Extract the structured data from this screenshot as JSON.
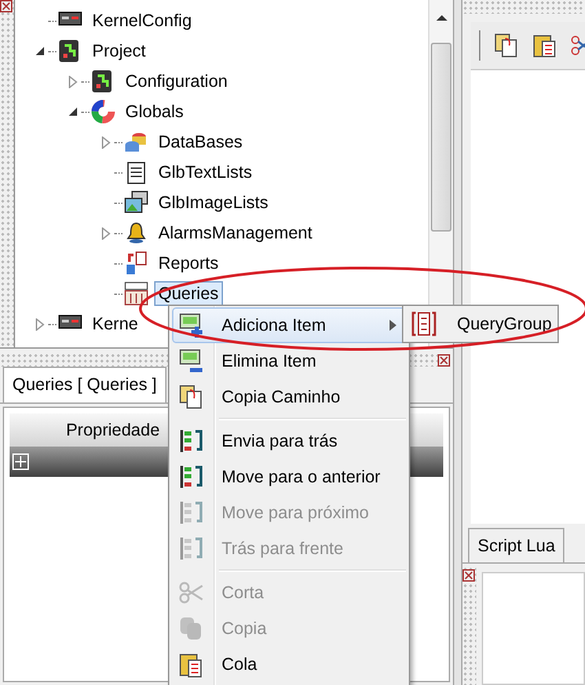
{
  "tree": [
    {
      "label": "KernelConfig",
      "kind": "config",
      "selected": false
    },
    {
      "label": "Project",
      "kind": "project",
      "selected": false,
      "expanded": true,
      "children": [
        {
          "label": "Configuration",
          "kind": "configuration",
          "selected": false,
          "expanded": false
        },
        {
          "label": "Globals",
          "kind": "globals",
          "selected": false,
          "expanded": true,
          "children": [
            {
              "label": "DataBases",
              "kind": "database",
              "selected": false,
              "expanded": false
            },
            {
              "label": "GlbTextLists",
              "kind": "textlist",
              "selected": false
            },
            {
              "label": "GlbImageLists",
              "kind": "imagelist",
              "selected": false
            },
            {
              "label": "AlarmsManagement",
              "kind": "alarm",
              "selected": false,
              "expanded": false
            },
            {
              "label": "Reports",
              "kind": "report",
              "selected": false
            },
            {
              "label": "Queries",
              "kind": "query",
              "selected": true
            }
          ]
        }
      ]
    },
    {
      "label": "Kerne",
      "kind": "kernel",
      "selected": false,
      "expanded": false
    }
  ],
  "properties_panel": {
    "tabs": [
      {
        "label": "Queries [ Queries ]",
        "selected": true
      }
    ],
    "column": "Propriedade"
  },
  "script_panel": {
    "tabs": [
      {
        "label": "Script Lua"
      }
    ]
  },
  "context_menu": [
    {
      "kind": "add",
      "label": "Adiciona Item",
      "disabled": false,
      "selected": true,
      "submenu": true
    },
    {
      "kind": "remove",
      "label": "Elimina Item",
      "disabled": false,
      "selected": false
    },
    {
      "kind": "copypath",
      "label": "Copia Caminho",
      "disabled": false,
      "selected": false
    },
    {
      "kind": "separator"
    },
    {
      "kind": "back",
      "label": "Envia para trás",
      "disabled": false,
      "selected": false
    },
    {
      "kind": "prev",
      "label": "Move para o anterior",
      "disabled": false,
      "selected": false
    },
    {
      "kind": "next",
      "label": "Move para próximo",
      "disabled": true,
      "selected": false
    },
    {
      "kind": "front",
      "label": "Trás para frente",
      "disabled": true,
      "selected": false
    },
    {
      "kind": "separator"
    },
    {
      "kind": "cut",
      "label": "Corta",
      "disabled": true,
      "selected": false
    },
    {
      "kind": "copy",
      "label": "Copia",
      "disabled": true,
      "selected": false
    },
    {
      "kind": "paste",
      "label": "Cola",
      "disabled": false,
      "selected": false
    }
  ],
  "submenu": [
    {
      "label": "QueryGroup"
    }
  ]
}
